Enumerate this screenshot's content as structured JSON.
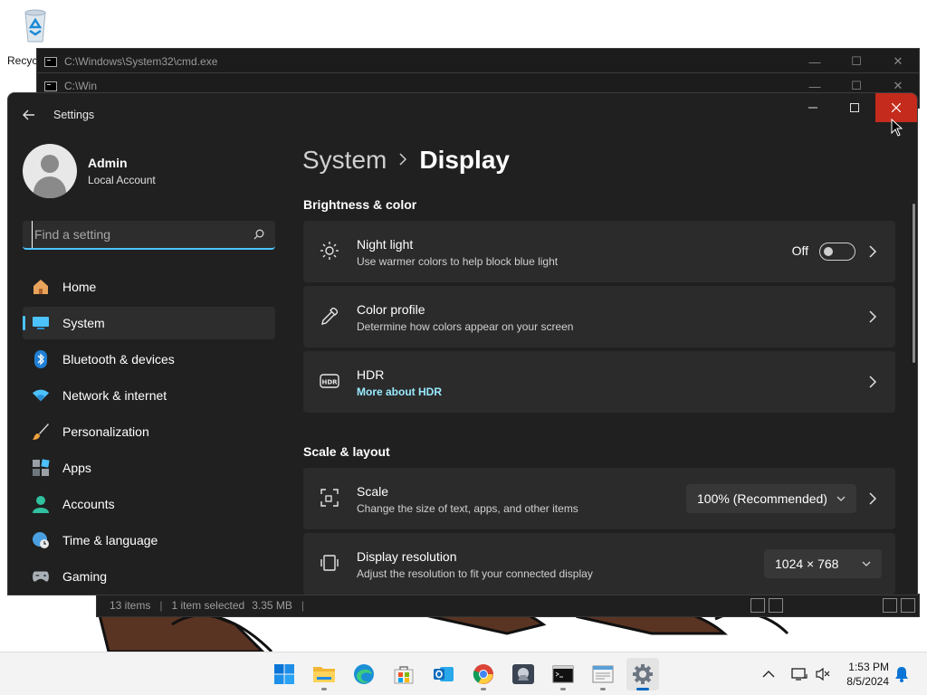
{
  "desktop": {
    "recycle_bin_label": "Recyc"
  },
  "cmd_windows": [
    {
      "title": "C:\\Windows\\System32\\cmd.exe"
    },
    {
      "title": "C:\\Win"
    }
  ],
  "explorer": {
    "items_count": "13 items",
    "selection": "1 item selected",
    "size": "3.35 MB"
  },
  "settings": {
    "app_title": "Settings",
    "profile": {
      "name": "Admin",
      "account_type": "Local Account"
    },
    "search": {
      "placeholder": "Find a setting",
      "value": ""
    },
    "nav": [
      {
        "label": "Home",
        "icon": "home-icon",
        "active": false
      },
      {
        "label": "System",
        "icon": "system-monitor-icon",
        "active": true
      },
      {
        "label": "Bluetooth & devices",
        "icon": "bluetooth-icon",
        "active": false
      },
      {
        "label": "Network & internet",
        "icon": "wifi-icon",
        "active": false
      },
      {
        "label": "Personalization",
        "icon": "brush-icon",
        "active": false
      },
      {
        "label": "Apps",
        "icon": "apps-icon",
        "active": false
      },
      {
        "label": "Accounts",
        "icon": "accounts-icon",
        "active": false
      },
      {
        "label": "Time & language",
        "icon": "globe-clock-icon",
        "active": false
      },
      {
        "label": "Gaming",
        "icon": "gamepad-icon",
        "active": false
      }
    ],
    "breadcrumb": {
      "parent": "System",
      "current": "Display"
    },
    "sections": {
      "brightness": "Brightness & color",
      "scale_layout": "Scale & layout"
    },
    "cards": {
      "night_light": {
        "title": "Night light",
        "subtitle": "Use warmer colors to help block blue light",
        "toggle_state": "Off",
        "icon": "brightness-sun-icon"
      },
      "color_profile": {
        "title": "Color profile",
        "subtitle": "Determine how colors appear on your screen",
        "icon": "eyedropper-icon"
      },
      "hdr": {
        "title": "HDR",
        "link": "More about HDR",
        "icon": "hdr-icon"
      },
      "scale": {
        "title": "Scale",
        "subtitle": "Change the size of text, apps, and other items",
        "value": "100% (Recommended)",
        "icon": "scale-icon"
      },
      "resolution": {
        "title": "Display resolution",
        "subtitle": "Adjust the resolution to fit your connected display",
        "value": "1024 × 768",
        "icon": "resolution-icon"
      }
    }
  },
  "taskbar": {
    "apps": [
      "start-icon",
      "file-explorer-icon",
      "edge-icon",
      "store-icon",
      "outlook-icon",
      "chrome-icon",
      "game-app-icon",
      "terminal-icon",
      "notepad-icon",
      "settings-icon"
    ],
    "time": "1:53 PM",
    "date": "8/5/2024"
  },
  "colors": {
    "accent": "#4cc2ff",
    "close_red": "#c42b1c",
    "taskbar_active": "#0067c0"
  }
}
